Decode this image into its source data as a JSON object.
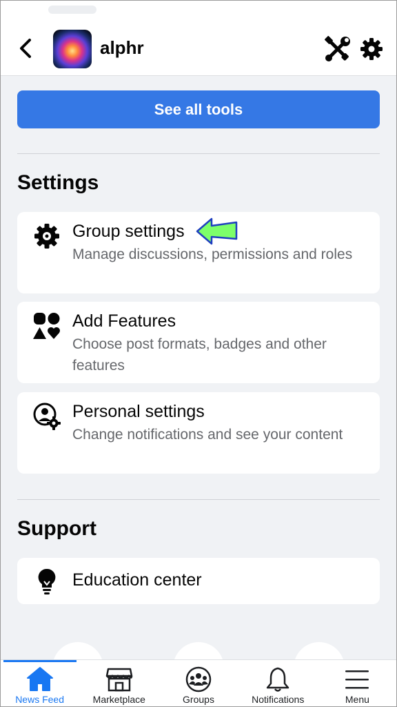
{
  "header": {
    "back_icon": "chevron-left-icon",
    "group_name": "alphr",
    "admin_tools_icon": "wrench-screwdriver-icon",
    "settings_icon": "gear-icon"
  },
  "tools_button": {
    "label": "See all tools"
  },
  "settings_section": {
    "title": "Settings",
    "items": [
      {
        "icon": "gear-icon",
        "title": "Group settings",
        "description": "Manage discussions, permissions and roles"
      },
      {
        "icon": "shapes-icon",
        "title": "Add Features",
        "description": "Choose post formats, badges and other features"
      },
      {
        "icon": "person-gear-icon",
        "title": "Personal settings",
        "description": "Change notifications and see your content"
      }
    ]
  },
  "support_section": {
    "title": "Support",
    "items": [
      {
        "icon": "lightbulb-icon",
        "title": "Education center"
      }
    ]
  },
  "annotation": {
    "icon": "green-arrow-icon",
    "color": "#7dff6a"
  },
  "tabbar": {
    "active_color": "#1877f2",
    "tabs": [
      {
        "label": "News Feed",
        "icon": "home-icon",
        "active": true
      },
      {
        "label": "Marketplace",
        "icon": "shop-icon",
        "active": false
      },
      {
        "label": "Groups",
        "icon": "groups-icon",
        "active": false
      },
      {
        "label": "Notifications",
        "icon": "bell-icon",
        "active": false
      },
      {
        "label": "Menu",
        "icon": "hamburger-icon",
        "active": false
      }
    ]
  },
  "colors": {
    "primary_button": "#3578e5",
    "background": "#f0f2f5",
    "secondary_text": "#65676b"
  }
}
